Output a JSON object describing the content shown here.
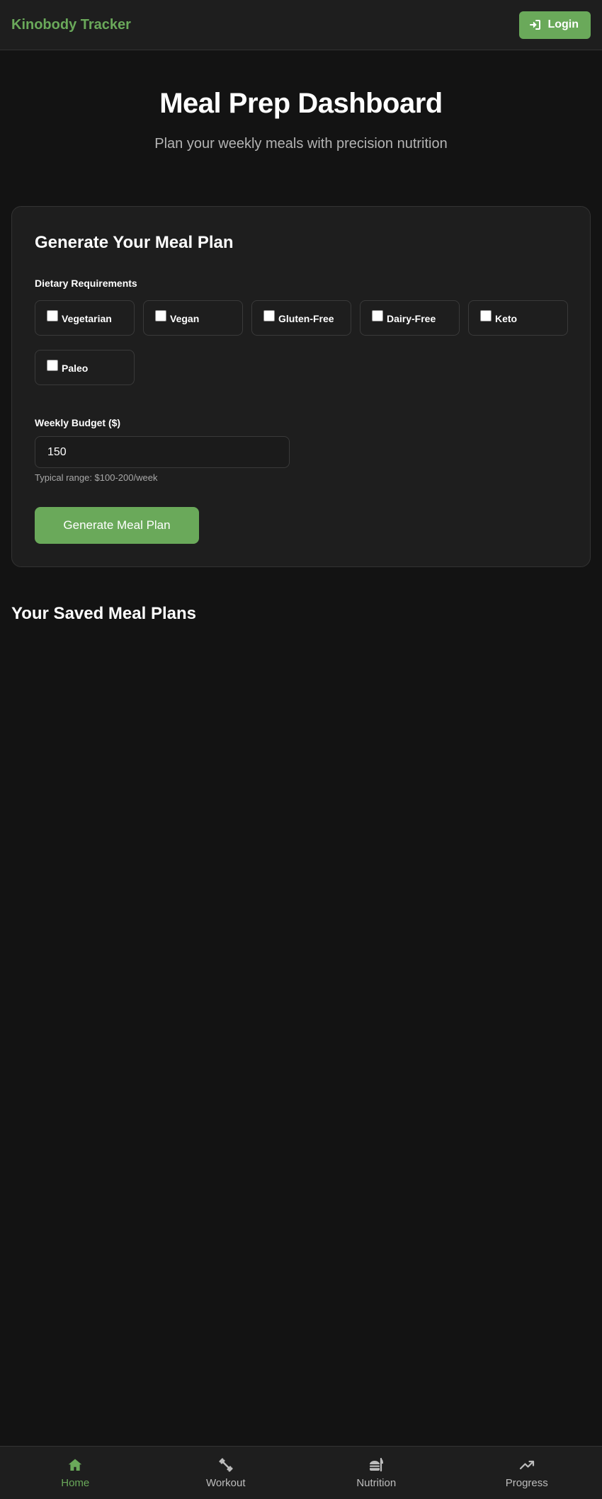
{
  "header": {
    "brand": "Kinobody Tracker",
    "login_label": "Login",
    "login_icon": "sign-in-icon"
  },
  "hero": {
    "title": "Meal Prep Dashboard",
    "subtitle": "Plan your weekly meals with precision nutrition"
  },
  "form": {
    "title": "Generate Your Meal Plan",
    "dietary_label": "Dietary Requirements",
    "options": [
      {
        "label": "Vegetarian",
        "checked": false
      },
      {
        "label": "Vegan",
        "checked": false
      },
      {
        "label": "Gluten-Free",
        "checked": false
      },
      {
        "label": "Dairy-Free",
        "checked": false
      },
      {
        "label": "Keto",
        "checked": false
      },
      {
        "label": "Paleo",
        "checked": false
      }
    ],
    "budget_label": "Weekly Budget ($)",
    "budget_value": "150",
    "budget_hint": "Typical range: $100-200/week",
    "generate_label": "Generate Meal Plan"
  },
  "saved": {
    "title": "Your Saved Meal Plans"
  },
  "bottom_nav": {
    "items": [
      {
        "label": "Home",
        "icon": "home-icon",
        "active": true
      },
      {
        "label": "Workout",
        "icon": "dumbbell-icon",
        "active": false
      },
      {
        "label": "Nutrition",
        "icon": "burger-icon",
        "active": false
      },
      {
        "label": "Progress",
        "icon": "trend-up-icon",
        "active": false
      }
    ]
  },
  "colors": {
    "accent": "#6aa95a",
    "background": "#131313",
    "surface": "#1e1e1e",
    "border": "#333333"
  }
}
